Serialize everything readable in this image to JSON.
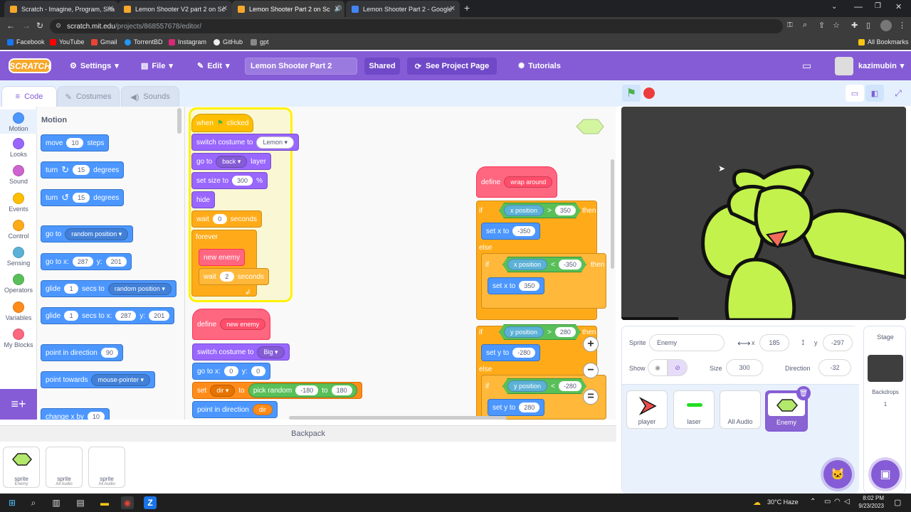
{
  "browser": {
    "tabs": [
      {
        "title": "Scratch - Imagine, Program, Sha",
        "color": "#f7a72a"
      },
      {
        "title": "Lemon Shooter V2 part 2 on Sc",
        "color": "#f7a72a"
      },
      {
        "title": "Lemon Shooter Part 2 on Sc",
        "color": "#f7a72a"
      },
      {
        "title": "Lemon Shooter Part 2 - Google",
        "color": "#4285f4"
      }
    ],
    "url_host": "scratch.mit.edu",
    "url_path": "/projects/868557678/editor/",
    "bookmarks": [
      "Facebook",
      "YouTube",
      "Gmail",
      "TorrentBD",
      "Instagram",
      "GitHub",
      "gpt"
    ],
    "all_bookmarks": "All Bookmarks"
  },
  "menu": {
    "logo": "SCRATCH",
    "settings": "Settings",
    "file": "File",
    "edit": "Edit",
    "project_title": "Lemon Shooter Part 2",
    "shared": "Shared",
    "see_project": "See Project Page",
    "tutorials": "Tutorials",
    "username": "kazimubin"
  },
  "editor_tabs": {
    "code": "Code",
    "costumes": "Costumes",
    "sounds": "Sounds"
  },
  "categories": [
    {
      "label": "Motion",
      "color": "#4c97ff"
    },
    {
      "label": "Looks",
      "color": "#9966ff"
    },
    {
      "label": "Sound",
      "color": "#cf63cf"
    },
    {
      "label": "Events",
      "color": "#ffbf00"
    },
    {
      "label": "Control",
      "color": "#ffab19"
    },
    {
      "label": "Sensing",
      "color": "#5cb1d6"
    },
    {
      "label": "Operators",
      "color": "#59c059"
    },
    {
      "label": "Variables",
      "color": "#ff8c1a"
    },
    {
      "label": "My Blocks",
      "color": "#ff6680"
    }
  ],
  "palette": {
    "heading": "Motion",
    "move": [
      "move",
      "10",
      "steps"
    ],
    "turn_cw": [
      "turn",
      "15",
      "degrees"
    ],
    "turn_ccw": [
      "turn",
      "15",
      "degrees"
    ],
    "goto": [
      "go to",
      "random position"
    ],
    "gotoxy": [
      "go to x:",
      "287",
      "y:",
      "201"
    ],
    "glide1": [
      "glide",
      "1",
      "secs to",
      "random position"
    ],
    "glide2": [
      "glide",
      "1",
      "secs to x:",
      "287",
      "y:",
      "201"
    ],
    "point_dir": [
      "point in direction",
      "90"
    ],
    "point_towards": [
      "point towards",
      "mouse-pointer"
    ],
    "change_x": [
      "change x by",
      "10"
    ]
  },
  "script1": {
    "when": "when",
    "clicked": "clicked",
    "switch_costume": "switch costume to",
    "costume": "Lemon",
    "go_to": "go to",
    "layer_val": "back",
    "layer": "layer",
    "set_size": "set size to",
    "size": "300",
    "pct": "%",
    "hide": "hide",
    "wait": "wait",
    "wait_val": "0",
    "seconds": "seconds",
    "forever": "forever",
    "new_enemy": "new enemy",
    "wait2_val": "2"
  },
  "script2": {
    "define": "define",
    "name": "new enemy",
    "switch_costume": "switch costume to",
    "costume": "Big",
    "gotox": "go to x:",
    "x": "0",
    "y_lbl": "y:",
    "y": "0",
    "set": "set",
    "var": "dir",
    "to": "to",
    "pick": "pick random",
    "min": "-180",
    "to2": "to",
    "max": "180",
    "point": "point in direction",
    "dir": "dir"
  },
  "script3": {
    "define": "define",
    "name": "wrap around",
    "if": "if",
    "xpos": "x position",
    "gt": ">",
    "v350": "350",
    "then": "then",
    "setx": "set x to",
    "m350": "-350",
    "else": "else",
    "lt": "<",
    "m350b": "-350",
    "p350": "350",
    "ypos": "y position",
    "v280": "280",
    "m280": "-280",
    "m280b": "-280",
    "sety": "set y to",
    "p280": "280"
  },
  "backpack": {
    "title": "Backpack",
    "items": [
      {
        "label": "sprite",
        "sub": "Enemy"
      },
      {
        "label": "sprite",
        "sub": "All Audio"
      },
      {
        "label": "sprite",
        "sub": "All Audio"
      }
    ]
  },
  "sprite_info": {
    "sprite_label": "Sprite",
    "sprite_name": "Enemy",
    "x_label": "x",
    "x": "185",
    "y_label": "y",
    "y": "-297",
    "show_label": "Show",
    "size_label": "Size",
    "size": "300",
    "direction_label": "Direction",
    "direction": "-32"
  },
  "sprites": [
    {
      "name": "player"
    },
    {
      "name": "laser"
    },
    {
      "name": "All Audio"
    },
    {
      "name": "Enemy"
    }
  ],
  "stage": {
    "title": "Stage",
    "backdrops_label": "Backdrops",
    "backdrops_count": "1"
  },
  "taskbar": {
    "weather": "30°C Haze",
    "time": "8:02 PM",
    "date": "9/23/2023"
  }
}
